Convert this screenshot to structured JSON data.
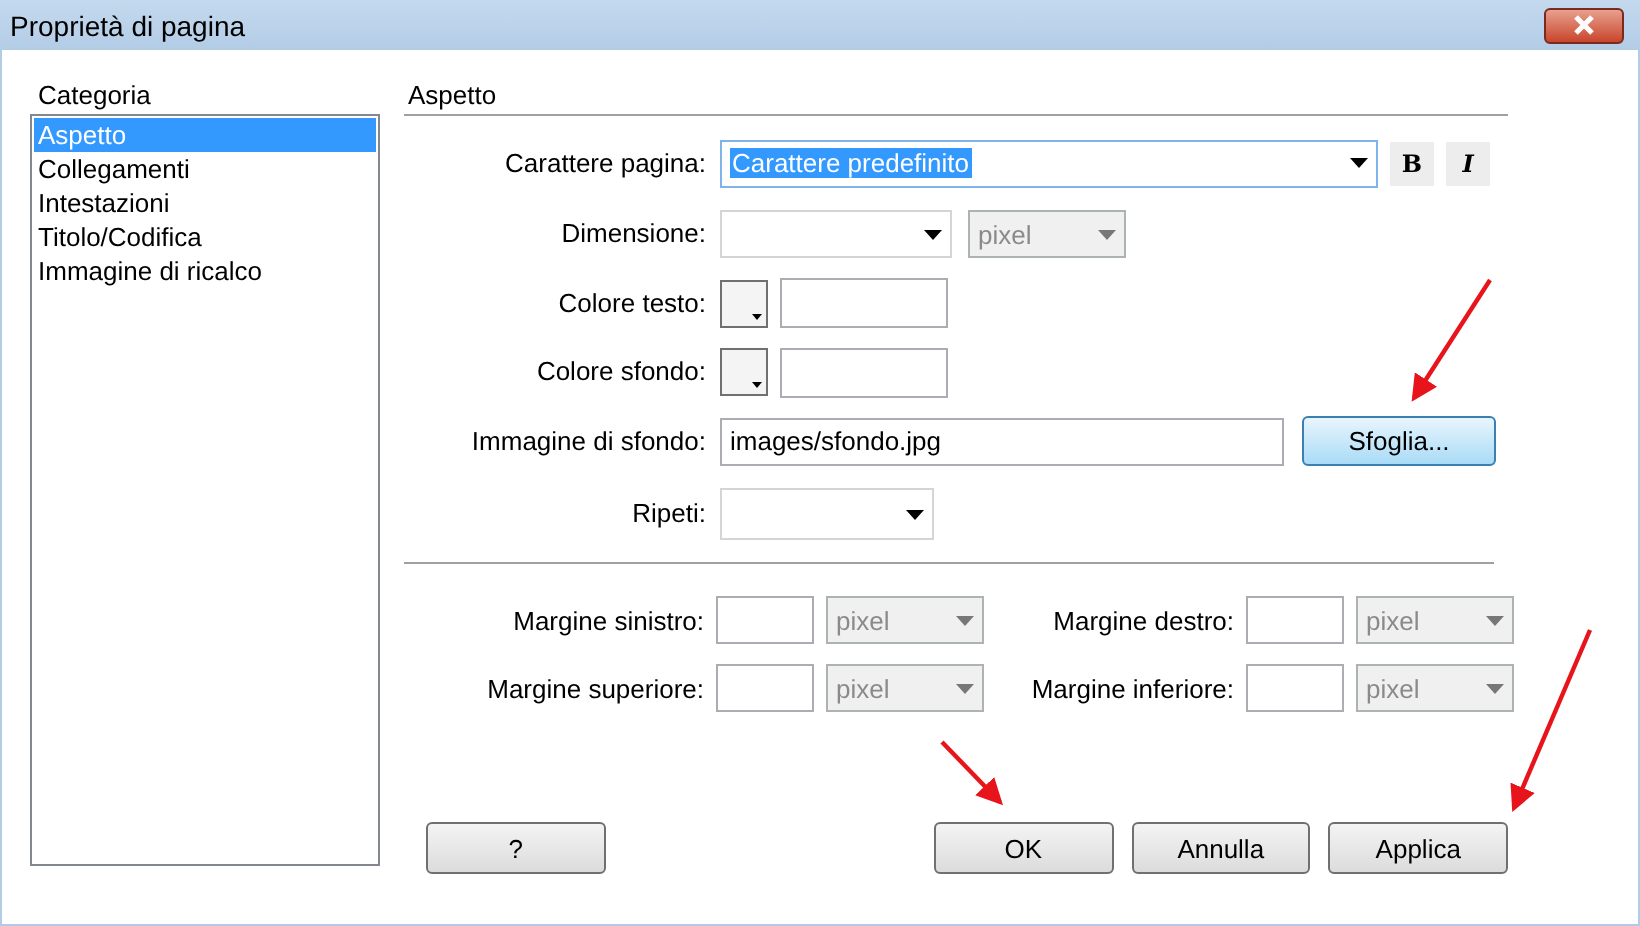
{
  "window": {
    "title": "Proprietà di pagina"
  },
  "category_list": {
    "label": "Categoria",
    "items": [
      {
        "label": "Aspetto",
        "selected": true
      },
      {
        "label": "Collegamenti",
        "selected": false
      },
      {
        "label": "Intestazioni",
        "selected": false
      },
      {
        "label": "Titolo/Codifica",
        "selected": false
      },
      {
        "label": "Immagine di ricalco",
        "selected": false
      }
    ]
  },
  "section": {
    "title": "Aspetto"
  },
  "font": {
    "label": "Carattere pagina:",
    "value": "Carattere predefinito",
    "highlighted": true,
    "bold_button": "B",
    "italic_button": "I"
  },
  "size": {
    "label": "Dimensione:",
    "unit": "pixel",
    "unit_disabled": true
  },
  "text_color": {
    "label": "Colore testo:"
  },
  "background_color": {
    "label": "Colore sfondo:"
  },
  "background_image": {
    "label": "Immagine di sfondo:",
    "value": "images/sfondo.jpg",
    "browse_button": "Sfoglia...",
    "browse_focused": true
  },
  "repeat": {
    "label": "Ripeti:"
  },
  "margins": [
    {
      "label": "Margine sinistro:",
      "unit": "pixel",
      "unit_disabled": true
    },
    {
      "label": "Margine destro:",
      "unit": "pixel",
      "unit_disabled": true
    },
    {
      "label": "Margine superiore:",
      "unit": "pixel",
      "unit_disabled": true
    },
    {
      "label": "Margine inferiore:",
      "unit": "pixel",
      "unit_disabled": true
    }
  ],
  "buttons": [
    {
      "label": "?"
    },
    {
      "label": "OK"
    },
    {
      "label": "Annulla"
    },
    {
      "label": "Applica"
    }
  ]
}
